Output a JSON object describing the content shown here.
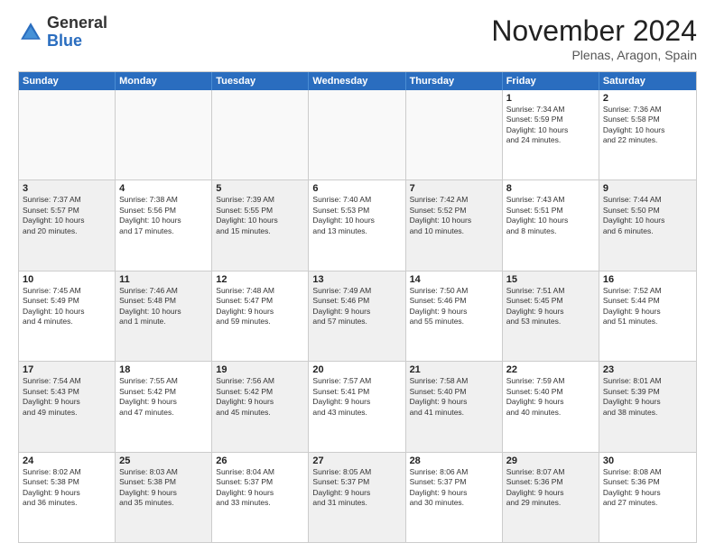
{
  "logo": {
    "general": "General",
    "blue": "Blue"
  },
  "title": "November 2024",
  "location": "Plenas, Aragon, Spain",
  "days": [
    "Sunday",
    "Monday",
    "Tuesday",
    "Wednesday",
    "Thursday",
    "Friday",
    "Saturday"
  ],
  "weeks": [
    [
      {
        "day": "",
        "empty": true
      },
      {
        "day": "",
        "empty": true
      },
      {
        "day": "",
        "empty": true
      },
      {
        "day": "",
        "empty": true
      },
      {
        "day": "",
        "empty": true
      },
      {
        "day": "1",
        "lines": [
          "Sunrise: 7:34 AM",
          "Sunset: 5:59 PM",
          "Daylight: 10 hours",
          "and 24 minutes."
        ]
      },
      {
        "day": "2",
        "lines": [
          "Sunrise: 7:36 AM",
          "Sunset: 5:58 PM",
          "Daylight: 10 hours",
          "and 22 minutes."
        ]
      }
    ],
    [
      {
        "day": "3",
        "shaded": true,
        "lines": [
          "Sunrise: 7:37 AM",
          "Sunset: 5:57 PM",
          "Daylight: 10 hours",
          "and 20 minutes."
        ]
      },
      {
        "day": "4",
        "lines": [
          "Sunrise: 7:38 AM",
          "Sunset: 5:56 PM",
          "Daylight: 10 hours",
          "and 17 minutes."
        ]
      },
      {
        "day": "5",
        "shaded": true,
        "lines": [
          "Sunrise: 7:39 AM",
          "Sunset: 5:55 PM",
          "Daylight: 10 hours",
          "and 15 minutes."
        ]
      },
      {
        "day": "6",
        "lines": [
          "Sunrise: 7:40 AM",
          "Sunset: 5:53 PM",
          "Daylight: 10 hours",
          "and 13 minutes."
        ]
      },
      {
        "day": "7",
        "shaded": true,
        "lines": [
          "Sunrise: 7:42 AM",
          "Sunset: 5:52 PM",
          "Daylight: 10 hours",
          "and 10 minutes."
        ]
      },
      {
        "day": "8",
        "lines": [
          "Sunrise: 7:43 AM",
          "Sunset: 5:51 PM",
          "Daylight: 10 hours",
          "and 8 minutes."
        ]
      },
      {
        "day": "9",
        "shaded": true,
        "lines": [
          "Sunrise: 7:44 AM",
          "Sunset: 5:50 PM",
          "Daylight: 10 hours",
          "and 6 minutes."
        ]
      }
    ],
    [
      {
        "day": "10",
        "lines": [
          "Sunrise: 7:45 AM",
          "Sunset: 5:49 PM",
          "Daylight: 10 hours",
          "and 4 minutes."
        ]
      },
      {
        "day": "11",
        "shaded": true,
        "lines": [
          "Sunrise: 7:46 AM",
          "Sunset: 5:48 PM",
          "Daylight: 10 hours",
          "and 1 minute."
        ]
      },
      {
        "day": "12",
        "lines": [
          "Sunrise: 7:48 AM",
          "Sunset: 5:47 PM",
          "Daylight: 9 hours",
          "and 59 minutes."
        ]
      },
      {
        "day": "13",
        "shaded": true,
        "lines": [
          "Sunrise: 7:49 AM",
          "Sunset: 5:46 PM",
          "Daylight: 9 hours",
          "and 57 minutes."
        ]
      },
      {
        "day": "14",
        "lines": [
          "Sunrise: 7:50 AM",
          "Sunset: 5:46 PM",
          "Daylight: 9 hours",
          "and 55 minutes."
        ]
      },
      {
        "day": "15",
        "shaded": true,
        "lines": [
          "Sunrise: 7:51 AM",
          "Sunset: 5:45 PM",
          "Daylight: 9 hours",
          "and 53 minutes."
        ]
      },
      {
        "day": "16",
        "lines": [
          "Sunrise: 7:52 AM",
          "Sunset: 5:44 PM",
          "Daylight: 9 hours",
          "and 51 minutes."
        ]
      }
    ],
    [
      {
        "day": "17",
        "shaded": true,
        "lines": [
          "Sunrise: 7:54 AM",
          "Sunset: 5:43 PM",
          "Daylight: 9 hours",
          "and 49 minutes."
        ]
      },
      {
        "day": "18",
        "lines": [
          "Sunrise: 7:55 AM",
          "Sunset: 5:42 PM",
          "Daylight: 9 hours",
          "and 47 minutes."
        ]
      },
      {
        "day": "19",
        "shaded": true,
        "lines": [
          "Sunrise: 7:56 AM",
          "Sunset: 5:42 PM",
          "Daylight: 9 hours",
          "and 45 minutes."
        ]
      },
      {
        "day": "20",
        "lines": [
          "Sunrise: 7:57 AM",
          "Sunset: 5:41 PM",
          "Daylight: 9 hours",
          "and 43 minutes."
        ]
      },
      {
        "day": "21",
        "shaded": true,
        "lines": [
          "Sunrise: 7:58 AM",
          "Sunset: 5:40 PM",
          "Daylight: 9 hours",
          "and 41 minutes."
        ]
      },
      {
        "day": "22",
        "lines": [
          "Sunrise: 7:59 AM",
          "Sunset: 5:40 PM",
          "Daylight: 9 hours",
          "and 40 minutes."
        ]
      },
      {
        "day": "23",
        "shaded": true,
        "lines": [
          "Sunrise: 8:01 AM",
          "Sunset: 5:39 PM",
          "Daylight: 9 hours",
          "and 38 minutes."
        ]
      }
    ],
    [
      {
        "day": "24",
        "lines": [
          "Sunrise: 8:02 AM",
          "Sunset: 5:38 PM",
          "Daylight: 9 hours",
          "and 36 minutes."
        ]
      },
      {
        "day": "25",
        "shaded": true,
        "lines": [
          "Sunrise: 8:03 AM",
          "Sunset: 5:38 PM",
          "Daylight: 9 hours",
          "and 35 minutes."
        ]
      },
      {
        "day": "26",
        "lines": [
          "Sunrise: 8:04 AM",
          "Sunset: 5:37 PM",
          "Daylight: 9 hours",
          "and 33 minutes."
        ]
      },
      {
        "day": "27",
        "shaded": true,
        "lines": [
          "Sunrise: 8:05 AM",
          "Sunset: 5:37 PM",
          "Daylight: 9 hours",
          "and 31 minutes."
        ]
      },
      {
        "day": "28",
        "lines": [
          "Sunrise: 8:06 AM",
          "Sunset: 5:37 PM",
          "Daylight: 9 hours",
          "and 30 minutes."
        ]
      },
      {
        "day": "29",
        "shaded": true,
        "lines": [
          "Sunrise: 8:07 AM",
          "Sunset: 5:36 PM",
          "Daylight: 9 hours",
          "and 29 minutes."
        ]
      },
      {
        "day": "30",
        "lines": [
          "Sunrise: 8:08 AM",
          "Sunset: 5:36 PM",
          "Daylight: 9 hours",
          "and 27 minutes."
        ]
      }
    ]
  ]
}
